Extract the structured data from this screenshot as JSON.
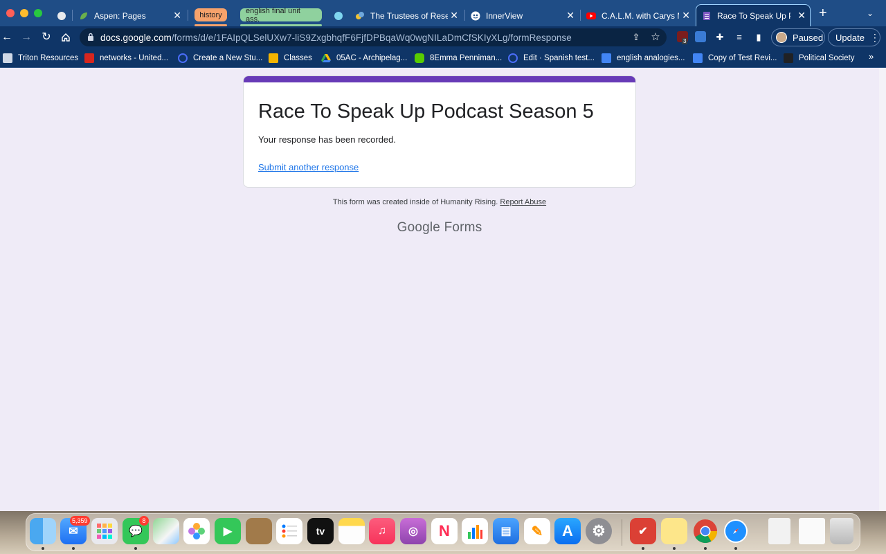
{
  "browser": {
    "tabs": [
      {
        "title": "",
        "favicon": "circle-icon"
      },
      {
        "title": "Aspen: Pages",
        "favicon": "aspen-leaf-icon"
      },
      {
        "title": "",
        "favicon": "circle-icon"
      },
      {
        "title": "The Trustees of Reser",
        "favicon": "trustees-icon"
      },
      {
        "title": "InnerView",
        "favicon": "innerview-icon"
      },
      {
        "title": "C.A.L.M. with Carys M",
        "favicon": "youtube-icon"
      },
      {
        "title": "Race To Speak Up Po",
        "favicon": "google-forms-icon"
      }
    ],
    "tab_groups": [
      {
        "label": "history",
        "color": "#f6a26b"
      },
      {
        "label": "english final unit ass.",
        "color": "#8fd19e"
      }
    ],
    "url_host": "docs.google.com",
    "url_path": "/forms/d/e/1FAIpQLSelUXw7-liS9ZxgbhqfF6FjfDPBqaWq0wgNILaDmCfSKIyXLg/formResponse",
    "profile_label": "Paused",
    "update_label": "Update",
    "extension_badge": "3",
    "bookmarks": [
      {
        "label": "Triton Resources",
        "icon": "folder-icon"
      },
      {
        "label": "networks - United...",
        "icon": "mcgraw-icon"
      },
      {
        "label": "Create a New Stu...",
        "icon": "q-icon"
      },
      {
        "label": "Classes",
        "icon": "classroom-icon"
      },
      {
        "label": "05AC - Archipelag...",
        "icon": "drive-icon"
      },
      {
        "label": "8Emma Penniman...",
        "icon": "duolingo-icon"
      },
      {
        "label": "Edit · Spanish test...",
        "icon": "q-icon"
      },
      {
        "label": "english analogies...",
        "icon": "docs-icon"
      },
      {
        "label": "Copy of Test Revi...",
        "icon": "docs-icon"
      },
      {
        "label": "Political Society",
        "icon": "book-icon"
      }
    ]
  },
  "form": {
    "title": "Race To Speak Up Podcast Season 5",
    "message": "Your response has been recorded.",
    "link": "Submit another response",
    "footer_prefix": "This form was created inside of Humanity Rising.",
    "footer_link": "Report Abuse",
    "brand_google": "Google",
    "brand_forms": "Forms",
    "accent_color": "#673ab7"
  },
  "dock": {
    "mail_badge": "5,359",
    "messages_badge": "8",
    "tv_label": "tv",
    "apps": [
      "finder",
      "mail",
      "launchpad",
      "messages",
      "maps",
      "photos",
      "facetime",
      "contacts",
      "reminders",
      "apple-tv",
      "notes",
      "music",
      "podcasts",
      "news",
      "numbers",
      "keynote",
      "pages",
      "app-store",
      "system-preferences",
      "todoist",
      "stickies",
      "chrome",
      "safari",
      "preview-file",
      "document-file",
      "trash"
    ]
  }
}
